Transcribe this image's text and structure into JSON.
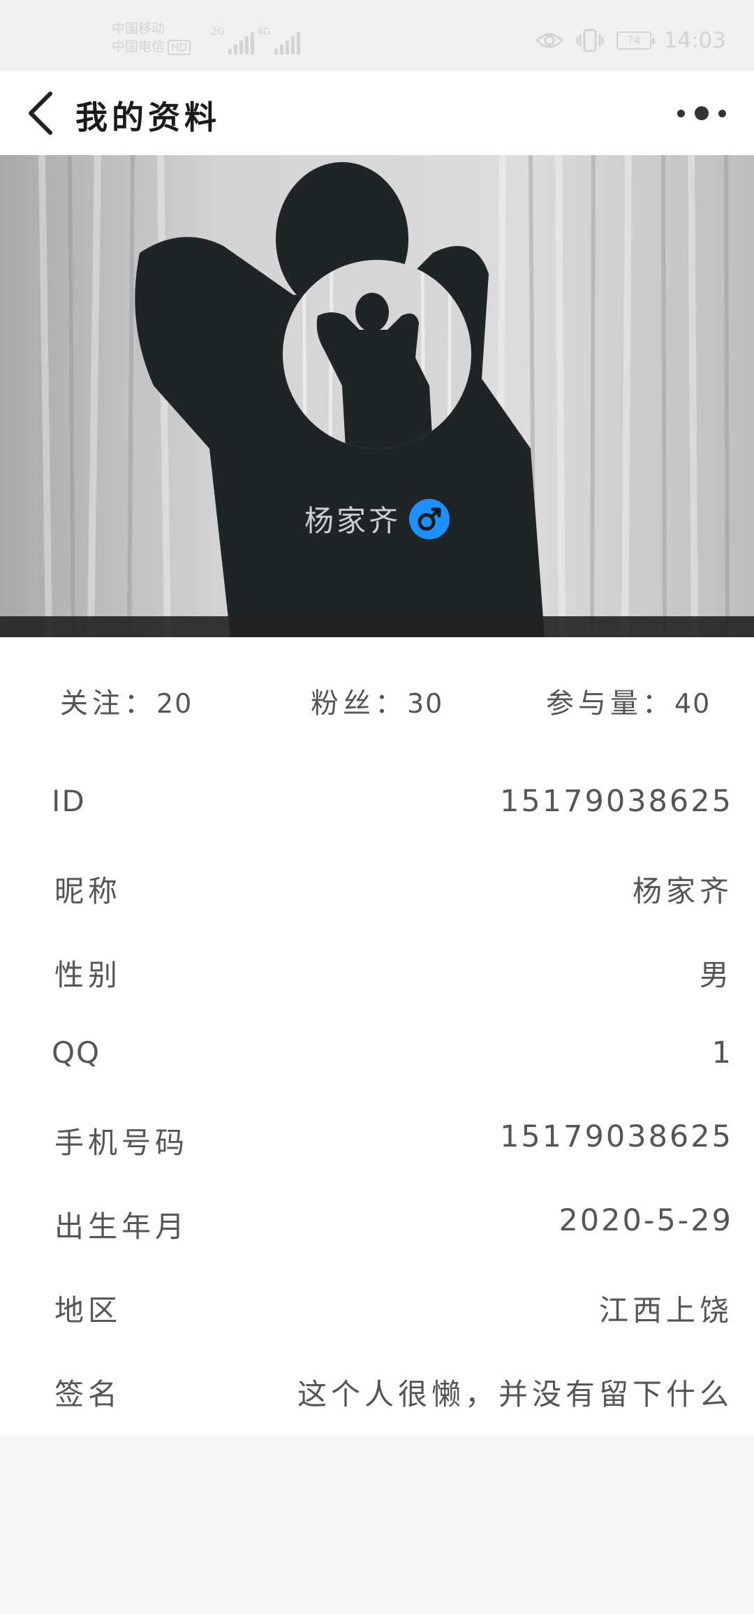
{
  "status_bar": {
    "carrier_1": "中国移动",
    "carrier_2": "中国电信",
    "hd_badge": "HD",
    "network_1": "2G",
    "network_2": "4G",
    "battery_level": "74",
    "time": "14:03",
    "icons": [
      "eye-icon",
      "vibrate-icon",
      "battery-icon"
    ]
  },
  "header": {
    "title": "我的资料",
    "back_icon": "chevron-left-icon",
    "more_icon": "more-dots-icon"
  },
  "profile": {
    "name": "杨家齐",
    "gender_icon": "male-icon",
    "gender_icon_color": "#1e90ff"
  },
  "stats": {
    "following_label": "关注：",
    "following_value": "20",
    "followers_label": "粉丝：",
    "followers_value": "30",
    "engagement_label": "参与量：",
    "engagement_value": "40"
  },
  "details": [
    {
      "label": "ID",
      "value": "15179038625"
    },
    {
      "label": "昵称",
      "value": "杨家齐"
    },
    {
      "label": "性别",
      "value": "男"
    },
    {
      "label": "QQ",
      "value": "1"
    },
    {
      "label": "手机号码",
      "value": "15179038625"
    },
    {
      "label": "出生年月",
      "value": "2020-5-29"
    },
    {
      "label": "地区",
      "value": "江西上饶"
    },
    {
      "label": "签名",
      "value": "这个人很懒，并没有留下什么"
    }
  ]
}
